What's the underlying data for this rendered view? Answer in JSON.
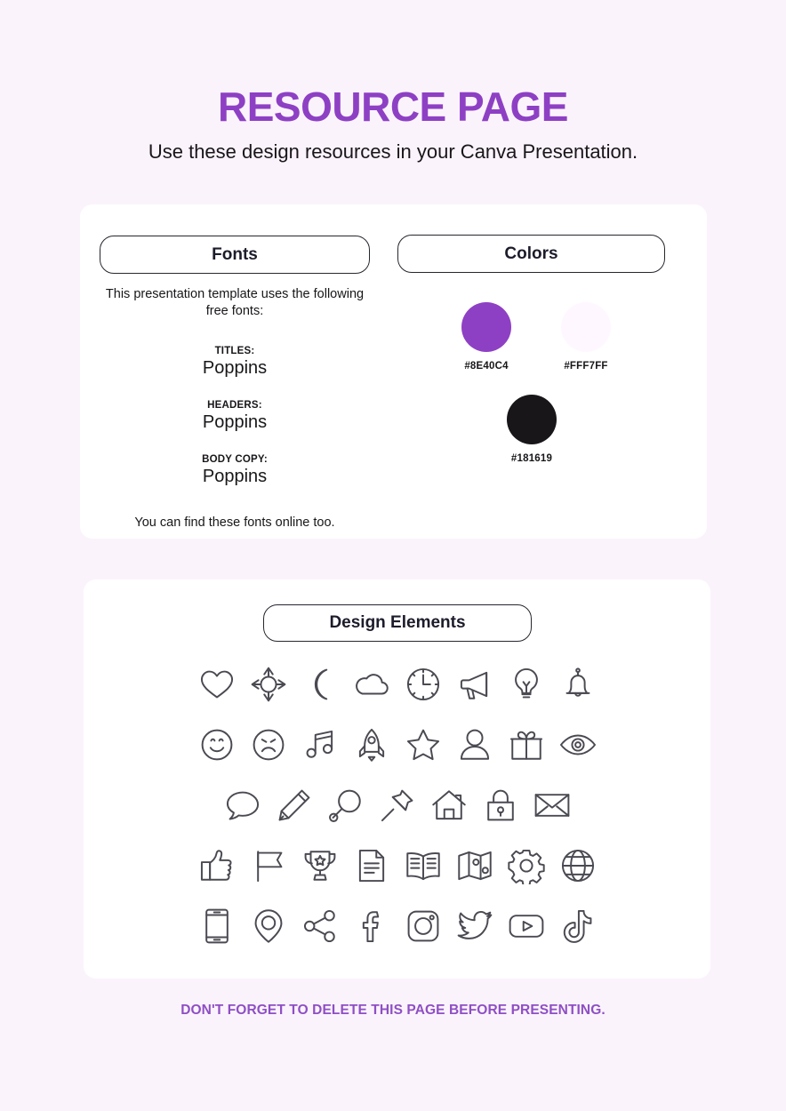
{
  "header": {
    "title": "RESOURCE PAGE",
    "subtitle": "Use these design resources in your Canva Presentation.",
    "title_color": "#8E40C4"
  },
  "fonts_section": {
    "pill_label": "Fonts",
    "intro": "This presentation template uses the following free fonts:",
    "groups": [
      {
        "label": "TITLES:",
        "name": "Poppins"
      },
      {
        "label": "HEADERS:",
        "name": "Poppins"
      },
      {
        "label": "BODY COPY:",
        "name": "Poppins"
      }
    ],
    "footnote": "You can find these fonts online too."
  },
  "colors_section": {
    "pill_label": "Colors",
    "swatches": [
      {
        "hex": "#8E40C4",
        "label": "#8E40C4"
      },
      {
        "hex": "#FFF7FF",
        "label": "#FFF7FF"
      },
      {
        "hex": "#181619",
        "label": "#181619"
      }
    ]
  },
  "design_elements_section": {
    "pill_label": "Design Elements",
    "rows": [
      [
        "heart-icon",
        "sun-icon",
        "moon-icon",
        "cloud-icon",
        "clock-icon",
        "megaphone-icon",
        "lightbulb-icon",
        "bell-icon"
      ],
      [
        "smiley-face-icon",
        "sad-face-icon",
        "music-note-icon",
        "rocket-icon",
        "star-icon",
        "person-icon",
        "gift-icon",
        "eye-icon"
      ],
      [
        "speech-bubble-icon",
        "pencil-icon",
        "magnifier-icon",
        "pushpin-icon",
        "house-icon",
        "lock-icon",
        "envelope-icon"
      ],
      [
        "thumbs-up-icon",
        "flag-icon",
        "trophy-icon",
        "document-icon",
        "book-icon",
        "map-icon",
        "gear-icon",
        "globe-icon"
      ],
      [
        "mobile-phone-icon",
        "location-pin-icon",
        "share-icon",
        "facebook-icon",
        "instagram-icon",
        "twitter-icon",
        "youtube-icon",
        "tiktok-icon"
      ]
    ]
  },
  "footer": {
    "note": "DON'T FORGET TO DELETE THIS PAGE BEFORE PRESENTING.",
    "note_color": "#8E4FC4"
  }
}
